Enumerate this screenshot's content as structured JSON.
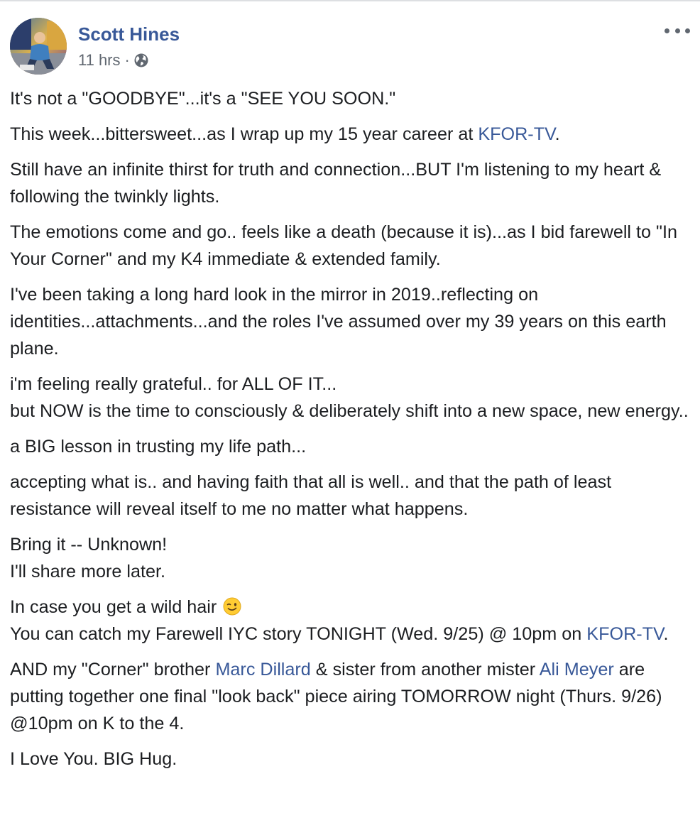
{
  "post": {
    "author": "Scott Hines",
    "timestamp": "11 hrs",
    "separator": "·",
    "privacy_icon": "globe-icon",
    "more_icon": "more-options-icon",
    "colors": {
      "link": "#385898",
      "text": "#1c1e21",
      "meta": "#606770"
    },
    "paragraphs": [
      {
        "lines": [
          {
            "text": "It's not a \"GOODBYE\"...it's a \"SEE YOU SOON.\""
          }
        ]
      },
      {
        "lines": [
          {
            "pre": "This week...bittersweet...as I wrap up my 15 year career at ",
            "link": "KFOR-TV",
            "post": "."
          }
        ]
      },
      {
        "lines": [
          {
            "text": "Still have an infinite thirst for truth and connection...BUT I'm listening to my heart & following the twinkly lights."
          }
        ]
      },
      {
        "lines": [
          {
            "text": "The emotions come and go.. feels like a death (because it is)...as I bid farewell to \"In Your Corner\" and my K4 immediate & extended family."
          }
        ]
      },
      {
        "lines": [
          {
            "text": "I've been taking a long hard look in the mirror in 2019..reflecting on identities...attachments...and the roles I've assumed over my 39 years on this earth plane."
          }
        ]
      },
      {
        "lines": [
          {
            "text": "i'm feeling really grateful.. for ALL OF IT..."
          },
          {
            "text": "but NOW is the time to consciously & deliberately shift into a new space, new energy.."
          }
        ]
      },
      {
        "lines": [
          {
            "text": "a BIG lesson in trusting my life path..."
          }
        ]
      },
      {
        "lines": [
          {
            "text": "accepting what is.. and having faith that all is well.. and that the path of least resistance will reveal itself to me no matter what happens."
          }
        ]
      },
      {
        "lines": [
          {
            "text": "Bring it -- Unknown!"
          },
          {
            "text": "I'll share more later."
          }
        ]
      },
      {
        "lines": [
          {
            "text": "In case you get a wild hair ",
            "emoji": "winking-face-emoji"
          },
          {
            "pre": "You can catch my Farewell IYC story TONIGHT (Wed. 9/25) @ 10pm on ",
            "link": "KFOR-TV",
            "post": "."
          }
        ]
      },
      {
        "lines": [
          {
            "pre": "AND my \"Corner\" brother ",
            "link": "Marc Dillard",
            "mid": " & sister from another mister ",
            "link2": "Ali Meyer",
            "post": " are putting together one final \"look back\" piece airing TOMORROW night (Thurs. 9/26) @10pm on K to the 4."
          }
        ]
      },
      {
        "lines": [
          {
            "text": "I Love You. BIG Hug."
          }
        ]
      }
    ]
  }
}
